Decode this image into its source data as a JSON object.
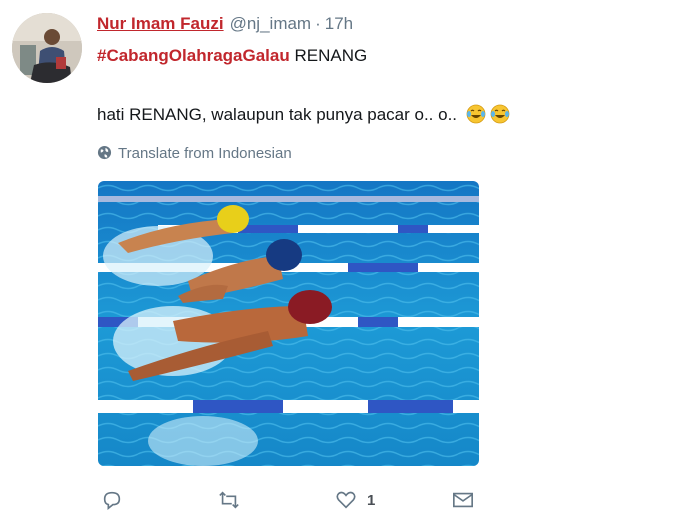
{
  "tweet": {
    "author_name": "Nur Imam Fauzi",
    "handle": "@nj_imam",
    "separator": "·",
    "time": "17h",
    "hashtag": "#CabangOlahragaGalau",
    "line1_rest": " RENANG",
    "line2_text": "hati RENANG, walaupun tak punya pacar o.. o..",
    "emojis": [
      "face-with-tears-of-joy",
      "face-with-tears-of-joy"
    ],
    "translate_label": "Translate from Indonesian",
    "media_description_icon": "swimmers-butterfly-photo",
    "actions": {
      "reply_icon": "reply-icon",
      "retweet_icon": "retweet-icon",
      "like_icon": "heart-icon",
      "like_count": "1",
      "message_icon": "envelope-icon"
    }
  },
  "colors": {
    "link_red": "#c1272d",
    "muted": "#657786",
    "pool_blue": "#1d9ad6"
  }
}
